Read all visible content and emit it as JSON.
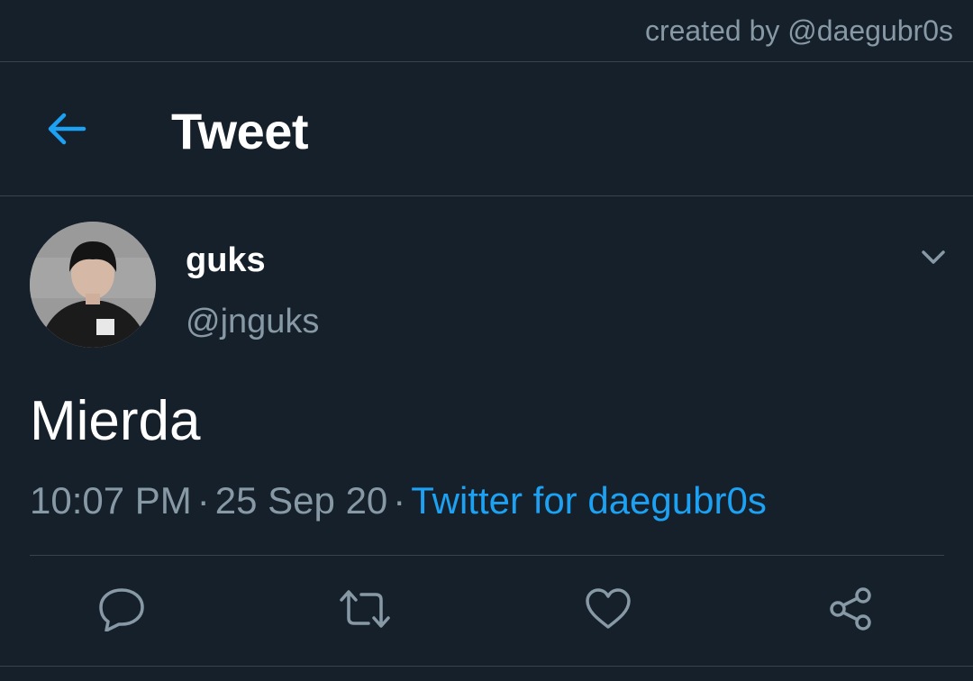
{
  "watermark": {
    "text": "created by @daegubr0s"
  },
  "header": {
    "title": "Tweet",
    "back_icon": "arrow-left-icon"
  },
  "tweet": {
    "display_name": "guks",
    "handle": "@jnguks",
    "text": "Mierda",
    "time": "10:07 PM",
    "separator": "·",
    "date": "25 Sep 20",
    "source": "Twitter for daegubr0s"
  },
  "actions": {
    "reply_icon": "reply-icon",
    "retweet_icon": "retweet-icon",
    "like_icon": "heart-icon",
    "share_icon": "share-icon"
  },
  "colors": {
    "background": "#15202b",
    "accent": "#1da1f2",
    "secondary_text": "#8899a6",
    "divider": "#38444d"
  }
}
